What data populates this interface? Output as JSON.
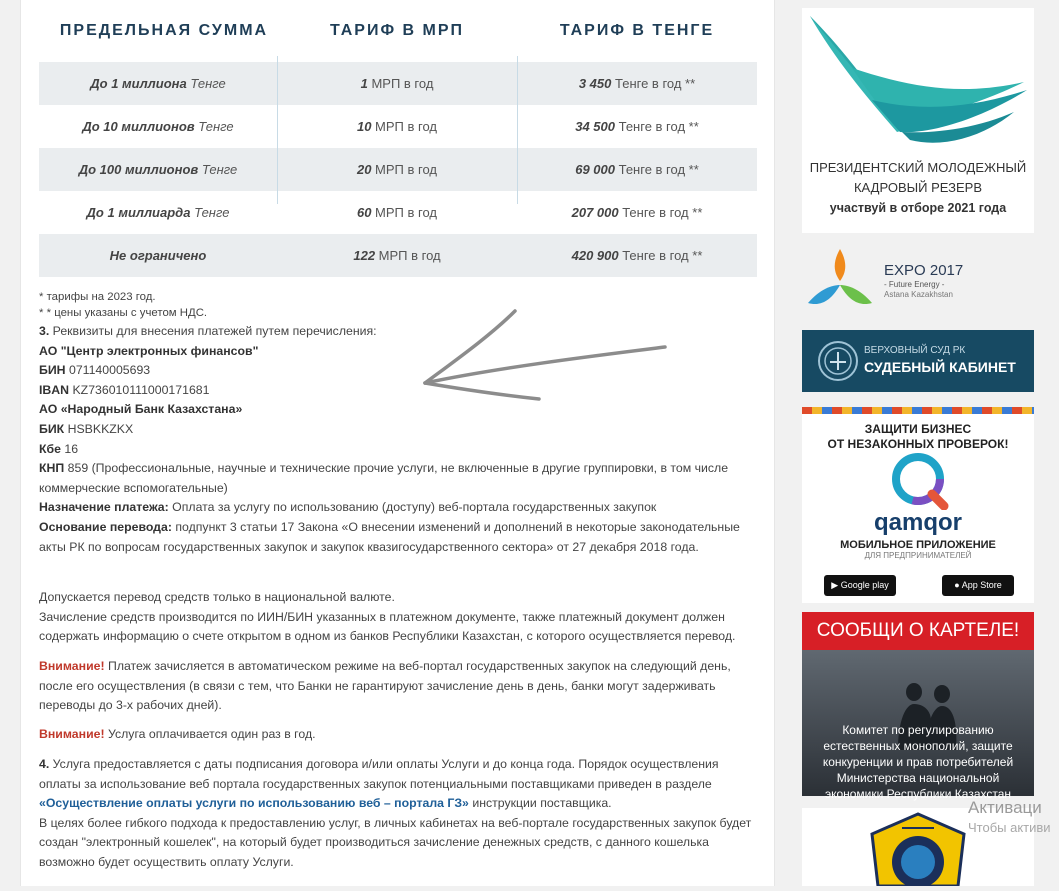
{
  "table": {
    "headers": [
      "ПРЕДЕЛЬНАЯ СУММА",
      "ТАРИФ В МРП",
      "ТАРИФ В ТЕНГЕ"
    ],
    "rows": [
      {
        "limit_b": "До 1 миллиона",
        "limit_unit": " Тенге",
        "mrp_b": "1",
        "mrp_unit": " МРП в год",
        "tenge_b": "3 450",
        "tenge_unit": " Тенге в год **"
      },
      {
        "limit_b": "До 10 миллионов",
        "limit_unit": " Тенге",
        "mrp_b": "10",
        "mrp_unit": " МРП в год",
        "tenge_b": "34 500",
        "tenge_unit": " Тенге в год **"
      },
      {
        "limit_b": "До 100 миллионов",
        "limit_unit": " Тенге",
        "mrp_b": "20",
        "mrp_unit": " МРП в год",
        "tenge_b": "69 000",
        "tenge_unit": " Тенге в год **"
      },
      {
        "limit_b": "До 1 миллиарда",
        "limit_unit": " Тенге",
        "mrp_b": "60",
        "mrp_unit": " МРП в год",
        "tenge_b": "207 000",
        "tenge_unit": " Тенге в год **"
      },
      {
        "limit_b": "Не ограничено",
        "limit_unit": "",
        "mrp_b": "122",
        "mrp_unit": " МРП в год",
        "tenge_b": "420 900",
        "tenge_unit": " Тенге в год **"
      }
    ]
  },
  "notes": {
    "tariff_year": "* тарифы на 2023 год.",
    "vat": "* * цены указаны с учетом НДС."
  },
  "requisites": {
    "num": "3.",
    "intro": " Реквизиты для внесения платежей путем перечисления:",
    "org": "АО \"Центр электронных финансов\"",
    "bin_label": "БИН",
    "bin_value": " 071140005693",
    "iban_label": "IBAN",
    "iban_value": " KZ736010111000171681",
    "bank": "АО «Народный Банк Казахстана»",
    "bik_label": "БИК",
    "bik_value": " HSBKKZKX",
    "kbe_label": "Кбе",
    "kbe_value": " 16",
    "knp_label": "КНП",
    "knp_value": " 859 (Профессиональные, научные и технические прочие услуги, не включенные в другие группировки, в том числе коммерческие вспомогательные)",
    "purpose_label": "Назначение платежа:",
    "purpose_value": " Оплата за услугу по использованию (доступу) веб-портала государственных закупок",
    "basis_label": "Основание перевода:",
    "basis_value": " подпункт 3 статьи 17 Закона «О внесении изменений и дополнений в некоторые законодательные акты РК по вопросам государственных закупок и закупок квазигосударственного сектора» от 27 декабря 2018 года."
  },
  "para": {
    "currency": "Допускается перевод средств только в национальной валюте.",
    "crediting": "Зачисление средств производится по ИИН/БИН указанных в платежном документе, также платежный документ должен содержать информацию о счете открытом в одном из банков Республики Казахстан, с которого осуществляется перевод.",
    "warn_label": "Внимание!",
    "warn1": " Платеж зачисляется в автоматическом режиме на веб-портал государственных закупок на следующий день, после его осуществления (в связи с тем, что Банки не гарантируют зачисление день в день, банки могут задерживать переводы до 3-х рабочих дней).",
    "warn2": " Услуга оплачивается один раз в год.",
    "p4_num": "4.",
    "p4_text": " Услуга предоставляется с даты подписания договора и/или оплаты Услуги и до конца года. Порядок осуществления оплаты за использование веб портала государственных закупок потенциальными поставщиками приведен в разделе ",
    "p4_link": "«Осуществление оплаты услуги по использованию веб – портала ГЗ»",
    "p4_tail": " инструкции поставщика.",
    "p5": "В целях более гибкого подхода к предоставлению услуг, в личных кабинетах на веб-портале государственных закупок будет создан \"электронный кошелек\", на который будет производиться зачисление денежных средств, с данного кошелька возможно будет осуществить оплату Услуги."
  },
  "sidebar": {
    "reserve_line1": "ПРЕЗИДЕНТСКИЙ МОЛОДЕЖНЫЙ",
    "reserve_line2": "КАДРОВЫЙ РЕЗЕРВ",
    "reserve_line3": "участвуй в отборе 2021 года",
    "expo_title": "EXPO 2017",
    "expo_sub": "- Future Energy -",
    "expo_city": "Astana Kazakhstan",
    "court_line1": "ВЕРХОВНЫЙ СУД РК",
    "court_line2": "СУДЕБНЫЙ КАБИНЕТ",
    "qamqor_top1": "ЗАЩИТИ БИЗНЕС",
    "qamqor_top2": "ОТ НЕЗАКОННЫХ ПРОВЕРОК!",
    "qamqor_brand": "qamqor",
    "qamqor_app": "МОБИЛЬНОЕ ПРИЛОЖЕНИЕ",
    "qamqor_for": "ДЛЯ ПРЕДПРИНИМАТЕЛЕЙ",
    "gplay": "Google play",
    "appstore": "App Store",
    "cartel_title": "СООБЩИ О КАРТЕЛЕ!",
    "cartel_text": "Комитет по регулированию естественных монополий, защите конкуренции и прав потребителей Министерства национальной экономики Республики Казахстан"
  },
  "watermark": {
    "line1": "Активаци",
    "line2": "Чтобы активи"
  },
  "colors": {
    "header_text": "#1f3e57",
    "row_alt": "#eaedef",
    "warning": "#c0392b",
    "link": "#1f5f98",
    "court_bg": "#174a63",
    "cartel_red": "#d71f26"
  }
}
